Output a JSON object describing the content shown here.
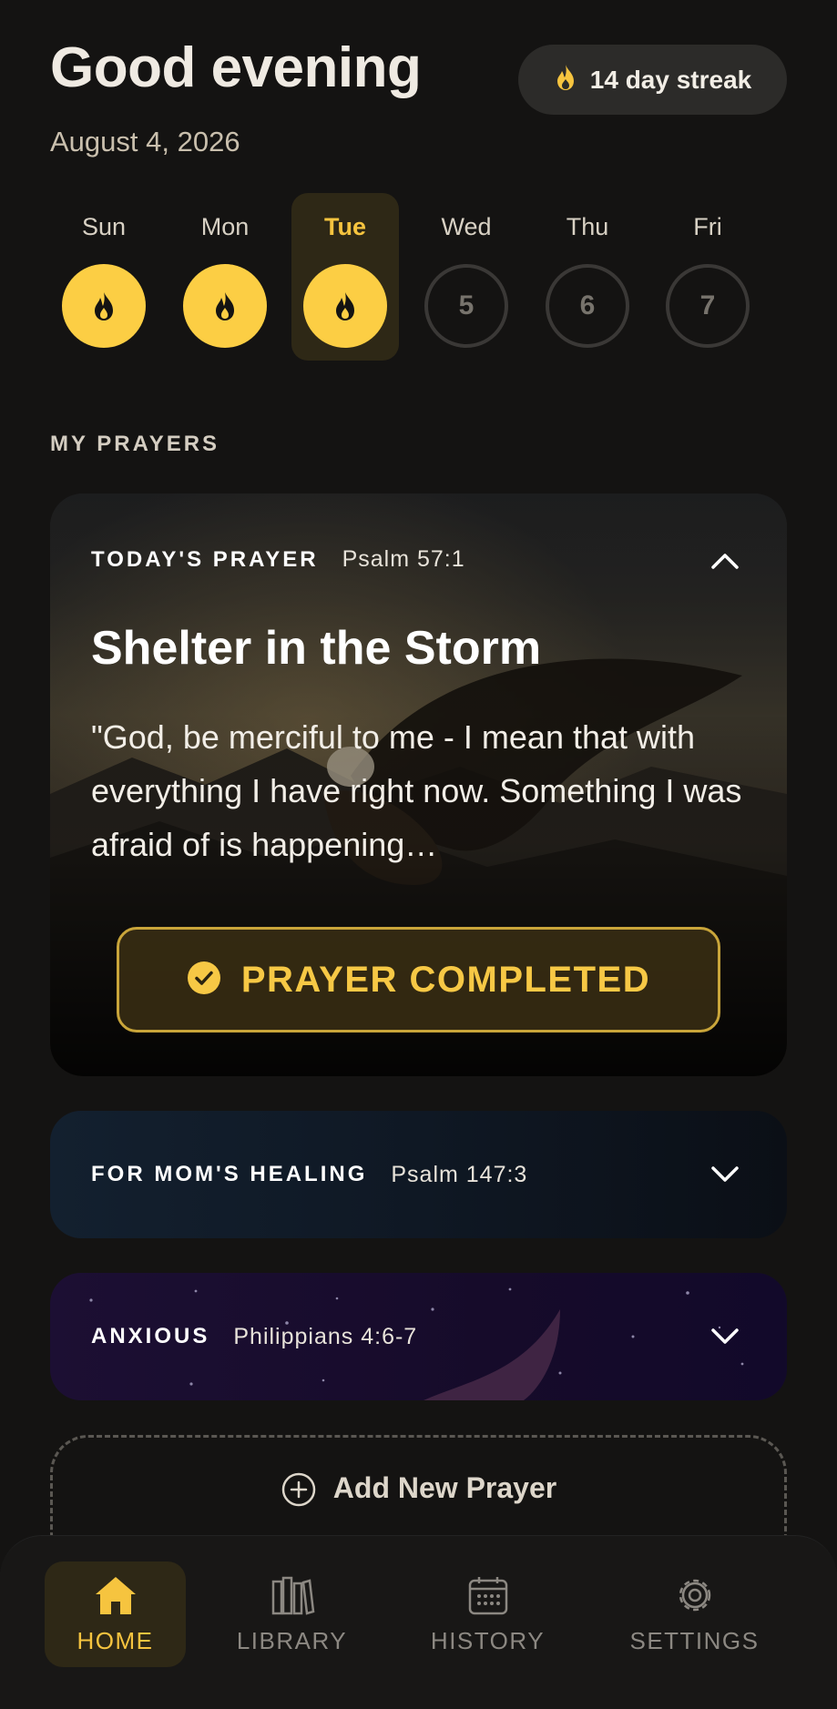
{
  "header": {
    "greeting": "Good evening",
    "date": "August 4, 2026"
  },
  "streak": {
    "label": "14 day streak",
    "icon": "flame-icon"
  },
  "week": [
    {
      "name": "Sun",
      "status": "done",
      "value": ""
    },
    {
      "name": "Mon",
      "status": "done",
      "value": ""
    },
    {
      "name": "Tue",
      "status": "done",
      "value": "",
      "active": true
    },
    {
      "name": "Wed",
      "status": "todo",
      "value": "5"
    },
    {
      "name": "Thu",
      "status": "todo",
      "value": "6"
    },
    {
      "name": "Fri",
      "status": "todo",
      "value": "7"
    }
  ],
  "section_label": "MY PRAYERS",
  "prayers": {
    "today": {
      "tag": "TODAY'S PRAYER",
      "reference": "Psalm 57:1",
      "title": "Shelter in the Storm",
      "quote": "\"God, be merciful to me - I mean that with everything I have right now. Something I was afraid of is happening…",
      "completed_label": "PRAYER COMPLETED",
      "expanded": true
    },
    "mom": {
      "tag": "FOR MOM'S HEALING",
      "reference": "Psalm 147:3",
      "expanded": false
    },
    "anxious": {
      "tag": "ANXIOUS",
      "reference": "Philippians 4:6-7",
      "expanded": false
    }
  },
  "add_prayer_label": "Add New Prayer",
  "nav": [
    {
      "label": "HOME",
      "icon": "home-icon",
      "active": true
    },
    {
      "label": "LIBRARY",
      "icon": "library-icon",
      "active": false
    },
    {
      "label": "HISTORY",
      "icon": "calendar-icon",
      "active": false
    },
    {
      "label": "SETTINGS",
      "icon": "gear-icon",
      "active": false
    }
  ],
  "colors": {
    "accent": "#fcce44",
    "background": "#141312"
  }
}
